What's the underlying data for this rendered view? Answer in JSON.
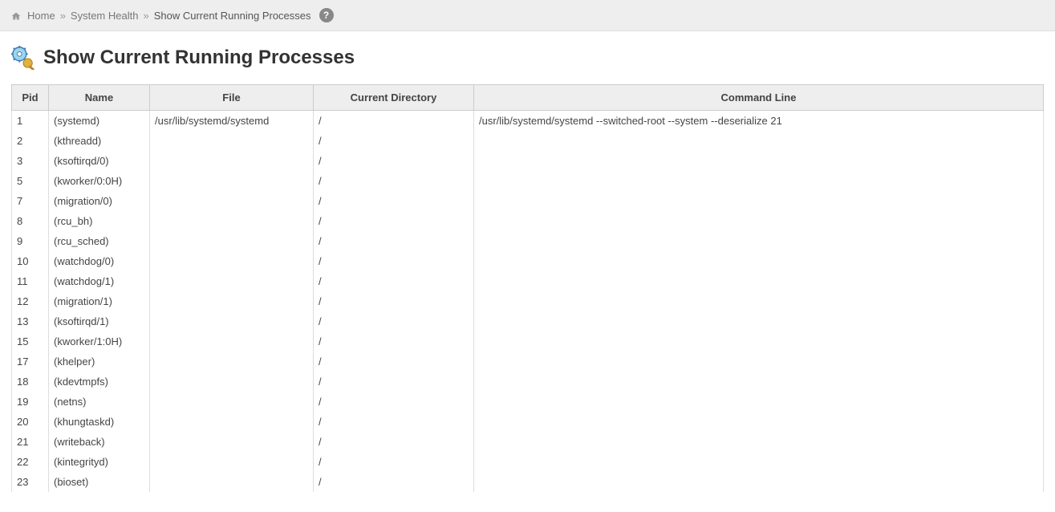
{
  "breadcrumb": {
    "home": "Home",
    "section": "System Health",
    "current": "Show Current Running Processes"
  },
  "page": {
    "title": "Show Current Running Processes"
  },
  "table": {
    "headers": {
      "pid": "Pid",
      "name": "Name",
      "file": "File",
      "cwd": "Current Directory",
      "cmd": "Command Line"
    },
    "rows": [
      {
        "pid": "1",
        "name": "(systemd)",
        "file": "/usr/lib/systemd/systemd",
        "cwd": "/",
        "cmd": "/usr/lib/systemd/systemd --switched-root --system --deserialize 21"
      },
      {
        "pid": "2",
        "name": "(kthreadd)",
        "file": "",
        "cwd": "/",
        "cmd": ""
      },
      {
        "pid": "3",
        "name": "(ksoftirqd/0)",
        "file": "",
        "cwd": "/",
        "cmd": ""
      },
      {
        "pid": "5",
        "name": "(kworker/0:0H)",
        "file": "",
        "cwd": "/",
        "cmd": ""
      },
      {
        "pid": "7",
        "name": "(migration/0)",
        "file": "",
        "cwd": "/",
        "cmd": ""
      },
      {
        "pid": "8",
        "name": "(rcu_bh)",
        "file": "",
        "cwd": "/",
        "cmd": ""
      },
      {
        "pid": "9",
        "name": "(rcu_sched)",
        "file": "",
        "cwd": "/",
        "cmd": ""
      },
      {
        "pid": "10",
        "name": "(watchdog/0)",
        "file": "",
        "cwd": "/",
        "cmd": ""
      },
      {
        "pid": "11",
        "name": "(watchdog/1)",
        "file": "",
        "cwd": "/",
        "cmd": ""
      },
      {
        "pid": "12",
        "name": "(migration/1)",
        "file": "",
        "cwd": "/",
        "cmd": ""
      },
      {
        "pid": "13",
        "name": "(ksoftirqd/1)",
        "file": "",
        "cwd": "/",
        "cmd": ""
      },
      {
        "pid": "15",
        "name": "(kworker/1:0H)",
        "file": "",
        "cwd": "/",
        "cmd": ""
      },
      {
        "pid": "17",
        "name": "(khelper)",
        "file": "",
        "cwd": "/",
        "cmd": ""
      },
      {
        "pid": "18",
        "name": "(kdevtmpfs)",
        "file": "",
        "cwd": "/",
        "cmd": ""
      },
      {
        "pid": "19",
        "name": "(netns)",
        "file": "",
        "cwd": "/",
        "cmd": ""
      },
      {
        "pid": "20",
        "name": "(khungtaskd)",
        "file": "",
        "cwd": "/",
        "cmd": ""
      },
      {
        "pid": "21",
        "name": "(writeback)",
        "file": "",
        "cwd": "/",
        "cmd": ""
      },
      {
        "pid": "22",
        "name": "(kintegrityd)",
        "file": "",
        "cwd": "/",
        "cmd": ""
      },
      {
        "pid": "23",
        "name": "(bioset)",
        "file": "",
        "cwd": "/",
        "cmd": ""
      }
    ]
  }
}
